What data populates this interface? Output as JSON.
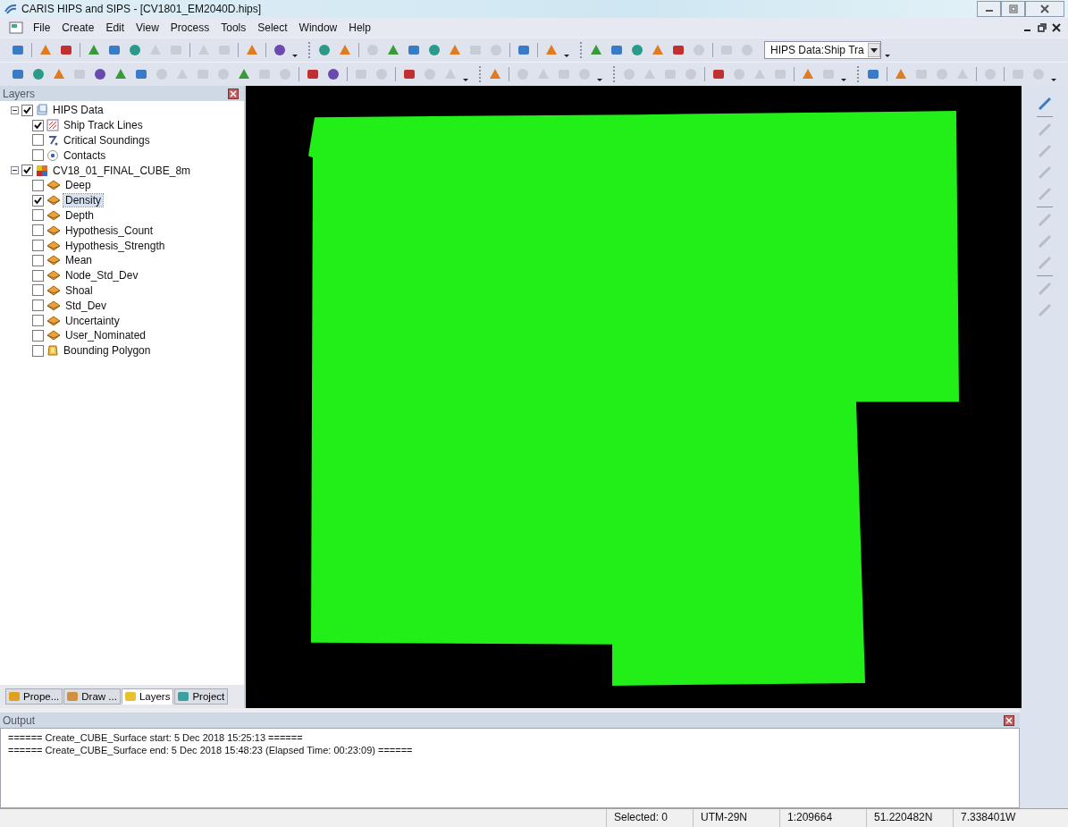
{
  "window": {
    "title": "CARIS HIPS and SIPS - [CV1801_EM2040D.hips]"
  },
  "menu": [
    "File",
    "Create",
    "Edit",
    "View",
    "Process",
    "Tools",
    "Select",
    "Window",
    "Help"
  ],
  "toolbars": [
    {
      "items": [
        {
          "kind": "button",
          "disabled": false
        },
        {
          "kind": "sep"
        },
        {
          "kind": "button",
          "disabled": false
        },
        {
          "kind": "button",
          "disabled": false
        },
        {
          "kind": "sep"
        },
        {
          "kind": "button",
          "disabled": false
        },
        {
          "kind": "button",
          "disabled": false
        },
        {
          "kind": "button",
          "disabled": false
        },
        {
          "kind": "button",
          "disabled": true
        },
        {
          "kind": "button",
          "disabled": true
        },
        {
          "kind": "sep"
        },
        {
          "kind": "button",
          "disabled": true
        },
        {
          "kind": "button",
          "disabled": true
        },
        {
          "kind": "sep"
        },
        {
          "kind": "button",
          "disabled": false
        },
        {
          "kind": "sep"
        },
        {
          "kind": "button",
          "disabled": false
        },
        {
          "kind": "more"
        },
        {
          "kind": "grip"
        },
        {
          "kind": "button",
          "disabled": false
        },
        {
          "kind": "button",
          "disabled": false
        },
        {
          "kind": "sep"
        },
        {
          "kind": "button",
          "disabled": true
        },
        {
          "kind": "button",
          "disabled": false
        },
        {
          "kind": "button",
          "disabled": false
        },
        {
          "kind": "button",
          "disabled": false
        },
        {
          "kind": "button",
          "disabled": false
        },
        {
          "kind": "button",
          "disabled": true
        },
        {
          "kind": "button",
          "disabled": true
        },
        {
          "kind": "sep"
        },
        {
          "kind": "button",
          "disabled": false
        },
        {
          "kind": "sep"
        },
        {
          "kind": "button",
          "disabled": false
        },
        {
          "kind": "more"
        },
        {
          "kind": "grip"
        },
        {
          "kind": "button",
          "disabled": false
        },
        {
          "kind": "button",
          "disabled": false
        },
        {
          "kind": "button",
          "disabled": false
        },
        {
          "kind": "button",
          "disabled": false
        },
        {
          "kind": "button",
          "disabled": false
        },
        {
          "kind": "button",
          "disabled": true
        },
        {
          "kind": "sep"
        },
        {
          "kind": "button",
          "disabled": true
        },
        {
          "kind": "button",
          "disabled": true
        },
        {
          "kind": "combo",
          "value": "HIPS Data:Ship Tra"
        },
        {
          "kind": "more"
        }
      ]
    },
    {
      "items": [
        {
          "kind": "button",
          "disabled": false
        },
        {
          "kind": "button",
          "disabled": false
        },
        {
          "kind": "button",
          "disabled": false
        },
        {
          "kind": "button",
          "disabled": true
        },
        {
          "kind": "button",
          "disabled": false
        },
        {
          "kind": "button",
          "disabled": false
        },
        {
          "kind": "button",
          "disabled": false
        },
        {
          "kind": "button",
          "disabled": true
        },
        {
          "kind": "button",
          "disabled": true
        },
        {
          "kind": "button",
          "disabled": true
        },
        {
          "kind": "button",
          "disabled": true
        },
        {
          "kind": "button",
          "disabled": false
        },
        {
          "kind": "button",
          "disabled": true
        },
        {
          "kind": "button",
          "disabled": true
        },
        {
          "kind": "sep"
        },
        {
          "kind": "button",
          "disabled": false
        },
        {
          "kind": "button",
          "disabled": false
        },
        {
          "kind": "sep"
        },
        {
          "kind": "button",
          "disabled": true
        },
        {
          "kind": "button",
          "disabled": true
        },
        {
          "kind": "sep"
        },
        {
          "kind": "button",
          "disabled": false
        },
        {
          "kind": "button",
          "disabled": true
        },
        {
          "kind": "button",
          "disabled": true
        },
        {
          "kind": "more"
        },
        {
          "kind": "grip"
        },
        {
          "kind": "button",
          "disabled": false
        },
        {
          "kind": "sep"
        },
        {
          "kind": "button",
          "disabled": true
        },
        {
          "kind": "button",
          "disabled": true
        },
        {
          "kind": "button",
          "disabled": true
        },
        {
          "kind": "button",
          "disabled": true
        },
        {
          "kind": "more"
        },
        {
          "kind": "grip"
        },
        {
          "kind": "button",
          "disabled": true
        },
        {
          "kind": "button",
          "disabled": true
        },
        {
          "kind": "button",
          "disabled": true
        },
        {
          "kind": "button",
          "disabled": true
        },
        {
          "kind": "sep"
        },
        {
          "kind": "button",
          "disabled": false
        },
        {
          "kind": "button",
          "disabled": true
        },
        {
          "kind": "button",
          "disabled": true
        },
        {
          "kind": "button",
          "disabled": true
        },
        {
          "kind": "sep"
        },
        {
          "kind": "button",
          "disabled": false
        },
        {
          "kind": "button",
          "disabled": true
        },
        {
          "kind": "more"
        },
        {
          "kind": "grip"
        },
        {
          "kind": "button",
          "disabled": false
        },
        {
          "kind": "sep"
        },
        {
          "kind": "button",
          "disabled": false
        },
        {
          "kind": "button",
          "disabled": true
        },
        {
          "kind": "button",
          "disabled": true
        },
        {
          "kind": "button",
          "disabled": true
        },
        {
          "kind": "sep"
        },
        {
          "kind": "button",
          "disabled": true
        },
        {
          "kind": "sep"
        },
        {
          "kind": "button",
          "disabled": true
        },
        {
          "kind": "button",
          "disabled": true
        },
        {
          "kind": "more"
        }
      ]
    }
  ],
  "layers_panel": {
    "title": "Layers",
    "tree": [
      {
        "label": "HIPS Data",
        "kind": "folder",
        "checked": true,
        "expanded": true,
        "selected": false,
        "children": [
          {
            "label": "Ship Track Lines",
            "kind": "tracklines",
            "checked": true,
            "selected": false
          },
          {
            "label": "Critical Soundings",
            "kind": "soundings",
            "checked": false,
            "selected": false
          },
          {
            "label": "Contacts",
            "kind": "contacts",
            "checked": false,
            "selected": false
          }
        ]
      },
      {
        "label": "CV18_01_FINAL_CUBE_8m",
        "kind": "surface",
        "checked": true,
        "expanded": true,
        "selected": false,
        "children": [
          {
            "label": "Deep",
            "kind": "attribute",
            "checked": false,
            "selected": false
          },
          {
            "label": "Density",
            "kind": "attribute",
            "checked": true,
            "selected": true
          },
          {
            "label": "Depth",
            "kind": "attribute",
            "checked": false,
            "selected": false
          },
          {
            "label": "Hypothesis_Count",
            "kind": "attribute",
            "checked": false,
            "selected": false
          },
          {
            "label": "Hypothesis_Strength",
            "kind": "attribute",
            "checked": false,
            "selected": false
          },
          {
            "label": "Mean",
            "kind": "attribute",
            "checked": false,
            "selected": false
          },
          {
            "label": "Node_Std_Dev",
            "kind": "attribute",
            "checked": false,
            "selected": false
          },
          {
            "label": "Shoal",
            "kind": "attribute",
            "checked": false,
            "selected": false
          },
          {
            "label": "Std_Dev",
            "kind": "attribute",
            "checked": false,
            "selected": false
          },
          {
            "label": "Uncertainty",
            "kind": "attribute",
            "checked": false,
            "selected": false
          },
          {
            "label": "User_Nominated",
            "kind": "attribute",
            "checked": false,
            "selected": false
          },
          {
            "label": "Bounding Polygon",
            "kind": "polygon",
            "checked": false,
            "selected": false
          }
        ]
      }
    ],
    "tabs": [
      {
        "label": "Prope...",
        "selected": false
      },
      {
        "label": "Draw ...",
        "selected": false
      },
      {
        "label": "Layers",
        "selected": true
      },
      {
        "label": "Project",
        "selected": false
      }
    ]
  },
  "side_toolbar": [
    {
      "disabled": false
    },
    {
      "kind": "sep"
    },
    {
      "disabled": true
    },
    {
      "disabled": true
    },
    {
      "disabled": true
    },
    {
      "disabled": true
    },
    {
      "kind": "sep"
    },
    {
      "disabled": true
    },
    {
      "disabled": true
    },
    {
      "disabled": true
    },
    {
      "kind": "sep"
    },
    {
      "disabled": true
    },
    {
      "disabled": true
    }
  ],
  "output": {
    "title": "Output",
    "lines": [
      "====== Create_CUBE_Surface start: 5 Dec 2018 15:25:13 ======",
      "====== Create_CUBE_Surface end: 5 Dec 2018 15:48:23 (Elapsed Time:  00:23:09) ======"
    ]
  },
  "status_bar": [
    "Selected: 0",
    "UTM-29N",
    "1:209664",
    "51.220482N",
    "7.338401W"
  ]
}
